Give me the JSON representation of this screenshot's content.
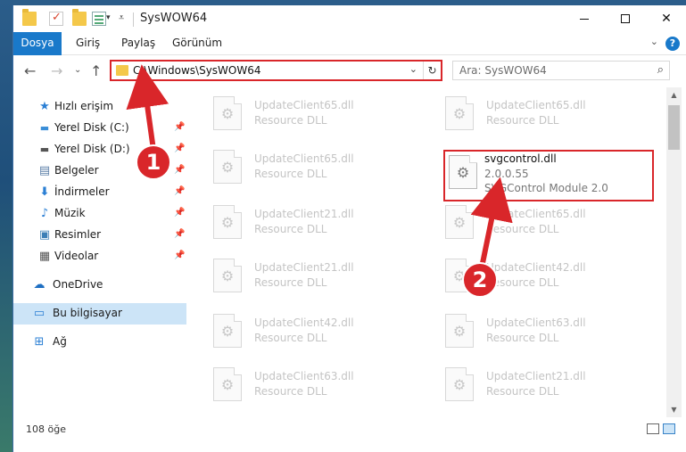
{
  "window": {
    "title": "SysWOW64"
  },
  "ribbon": {
    "tabs": [
      {
        "label": "Dosya",
        "active": true
      },
      {
        "label": "Giriş"
      },
      {
        "label": "Paylaş"
      },
      {
        "label": "Görünüm"
      }
    ],
    "help": "?"
  },
  "nav": {
    "address": "C:\\Windows\\SysWOW64",
    "search_placeholder": "Ara: SysWOW64"
  },
  "sidebar": {
    "items": [
      {
        "label": "Hızlı erişim",
        "icon": "star-icon",
        "pinned": false
      },
      {
        "label": "Yerel Disk (C:)",
        "icon": "drive-icon",
        "pinned": true
      },
      {
        "label": "Yerel Disk (D:)",
        "icon": "drive-icon",
        "pinned": true
      },
      {
        "label": "Belgeler",
        "icon": "documents-icon",
        "pinned": true
      },
      {
        "label": "İndirmeler",
        "icon": "download-icon",
        "pinned": true
      },
      {
        "label": "Müzik",
        "icon": "music-icon",
        "pinned": true
      },
      {
        "label": "Resimler",
        "icon": "pictures-icon",
        "pinned": true
      },
      {
        "label": "Videolar",
        "icon": "videos-icon",
        "pinned": true
      },
      {
        "label": "OneDrive",
        "icon": "cloud-icon",
        "pinned": false
      },
      {
        "label": "Bu bilgisayar",
        "icon": "computer-icon",
        "pinned": false,
        "selected": true
      },
      {
        "label": "Ağ",
        "icon": "network-icon",
        "pinned": false
      }
    ]
  },
  "files": {
    "left": [
      {
        "name": "UpdateClient65.dll",
        "sub": "Resource DLL"
      },
      {
        "name": "UpdateClient65.dll",
        "sub": "Resource DLL"
      },
      {
        "name": "UpdateClient21.dll",
        "sub": "Resource DLL"
      },
      {
        "name": "UpdateClient21.dll",
        "sub": "Resource DLL"
      },
      {
        "name": "UpdateClient42.dll",
        "sub": "Resource DLL"
      },
      {
        "name": "UpdateClient63.dll",
        "sub": "Resource DLL"
      }
    ],
    "right": [
      {
        "name": "UpdateClient65.dll",
        "sub": "Resource DLL"
      },
      {
        "name": "svgcontrol.dll",
        "sub": "2.0.0.55",
        "sub2": "SVGControl Module 2.0",
        "highlight": true
      },
      {
        "name": "UpdateClient65.dll",
        "sub": "Resource DLL"
      },
      {
        "name": "UpdateClient42.dll",
        "sub": "Resource DLL"
      },
      {
        "name": "UpdateClient63.dll",
        "sub": "Resource DLL"
      },
      {
        "name": "UpdateClient21.dll",
        "sub": "Resource DLL"
      }
    ]
  },
  "status": {
    "count": "108 öğe"
  },
  "annotations": {
    "step1": "1",
    "step2": "2"
  },
  "colors": {
    "accent": "#1979ca",
    "annotation": "#d9262a",
    "selection": "#cce4f7"
  }
}
